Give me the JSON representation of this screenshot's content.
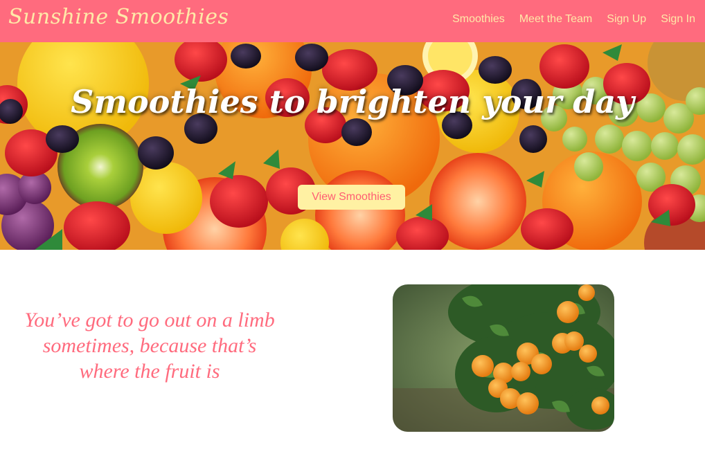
{
  "brand": "Sunshine Smoothies",
  "nav": {
    "items": [
      {
        "label": "Smoothies"
      },
      {
        "label": "Meet the Team"
      },
      {
        "label": "Sign Up"
      },
      {
        "label": "Sign In"
      }
    ]
  },
  "hero": {
    "title": "Smoothies to brighten your day",
    "button_label": "View Smoothies"
  },
  "quote": {
    "text": "You’ve got to go out on a limb sometimes, because that’s where the fruit is"
  },
  "colors": {
    "navbar": "#ff6b7e",
    "nav_text": "#ffe9a8",
    "button_bg": "#fff1a3",
    "button_text": "#ff5d73",
    "quote_text": "#ff6b7e"
  }
}
